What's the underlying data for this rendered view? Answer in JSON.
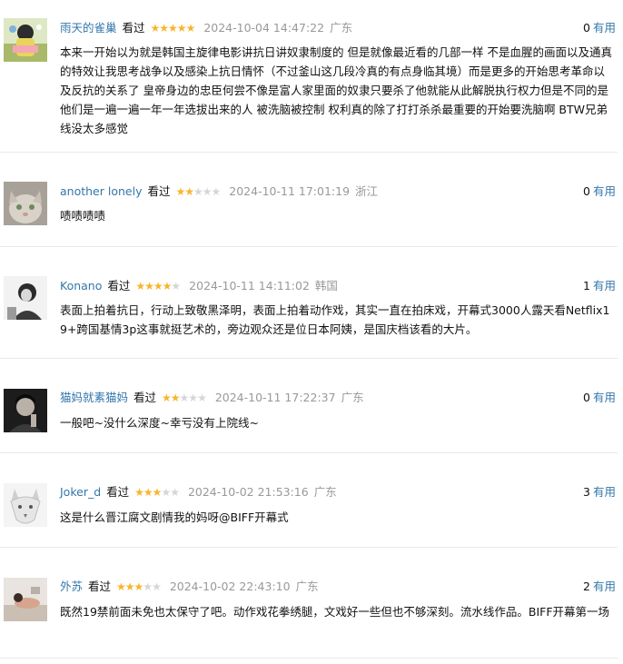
{
  "comments": [
    {
      "user": "雨天的雀巢",
      "status": "看过",
      "stars": 5,
      "time": "2024-10-04 14:47:22",
      "location": "广东",
      "votes": "0",
      "useful_label": "有用",
      "text": "本来一开始以为就是韩国主旋律电影讲抗日讲奴隶制度的 但是就像最近看的几部一样 不是血腥的画面以及通真的特效让我思考战争以及感染上抗日情怀（不过釜山这几段冷真的有点身临其境）而是更多的开始思考革命以及反抗的关系了 皇帝身边的忠臣何尝不像是富人家里面的奴隶只要杀了他就能从此解脱执行权力但是不同的是他们是一遍一遍一年一年选拔出来的人 被洗脑被控制 权利真的除了打打杀杀最重要的开始要洗脑啊 BTW兄弟线没太多感觉",
      "avatar_theme": "colorful-figure"
    },
    {
      "user": "another lonely",
      "status": "看过",
      "stars": 2,
      "time": "2024-10-11 17:01:19",
      "location": "浙江",
      "votes": "0",
      "useful_label": "有用",
      "text": "啧啧啧啧",
      "avatar_theme": "cat"
    },
    {
      "user": "Konano",
      "status": "看过",
      "stars": 4,
      "time": "2024-10-11 14:11:02",
      "location": "韩国",
      "votes": "1",
      "useful_label": "有用",
      "text": "表面上拍着抗日，行动上致敬黑泽明，表面上拍着动作戏，其实一直在拍床戏，开幕式3000人露天看Netflix19+跨国基情3p这事就挺艺术的，旁边观众还是位日本阿姨，是国庆档该看的大片。",
      "avatar_theme": "bw-portrait"
    },
    {
      "user": "猫妈就素猫妈",
      "status": "看过",
      "stars": 2,
      "time": "2024-10-11 17:22:37",
      "location": "广东",
      "votes": "0",
      "useful_label": "有用",
      "text": "一般吧~没什么深度~幸亏没有上院线~",
      "avatar_theme": "dark-portrait"
    },
    {
      "user": "Joker_d",
      "status": "看过",
      "stars": 3,
      "time": "2024-10-02 21:53:16",
      "location": "广东",
      "votes": "3",
      "useful_label": "有用",
      "text": "这是什么晋江腐文剧情我的妈呀@BIFF开幕式",
      "avatar_theme": "white-wolf"
    },
    {
      "user": "外苏",
      "status": "看过",
      "stars": 3,
      "time": "2024-10-02 22:43:10",
      "location": "广东",
      "votes": "2",
      "useful_label": "有用",
      "text": "既然19禁前面未免也太保守了吧。动作戏花拳绣腿，文戏好一些但也不够深刻。流水线作品。BIFF开幕第一场",
      "avatar_theme": "soft-photo"
    }
  ]
}
